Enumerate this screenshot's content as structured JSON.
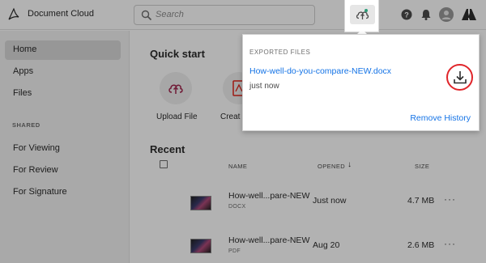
{
  "app": {
    "brand": "Document Cloud"
  },
  "search": {
    "placeholder": "Search"
  },
  "sidebar": {
    "items": [
      {
        "label": "Home"
      },
      {
        "label": "Apps"
      },
      {
        "label": "Files"
      }
    ],
    "shared_heading": "SHARED",
    "shared_items": [
      {
        "label": "For Viewing"
      },
      {
        "label": "For Review"
      },
      {
        "label": "For Signature"
      }
    ]
  },
  "main": {
    "quick_start_title": "Quick start",
    "quick_start": [
      {
        "label": "Upload File"
      },
      {
        "label": "Creat"
      }
    ],
    "recent_title": "Recent",
    "columns": {
      "name": "NAME",
      "opened": "OPENED",
      "sort_arrow": "↓",
      "size": "SIZE"
    },
    "rows": [
      {
        "name": "How-well...pare-NEW",
        "type": "DOCX",
        "opened": "Just now",
        "size": "4.7 MB",
        "more": "···"
      },
      {
        "name": "How-well...pare-NEW",
        "type": "PDF",
        "opened": "Aug 20",
        "size": "2.6 MB",
        "more": "···"
      }
    ]
  },
  "popover": {
    "title": "EXPORTED FILES",
    "file_name": "How-well-do-you-compare-NEW.docx",
    "time": "just now",
    "remove_label": "Remove History"
  },
  "colors": {
    "accent": "#1473e6",
    "highlight_ring": "#e0252a",
    "brand": "#e1251b"
  }
}
